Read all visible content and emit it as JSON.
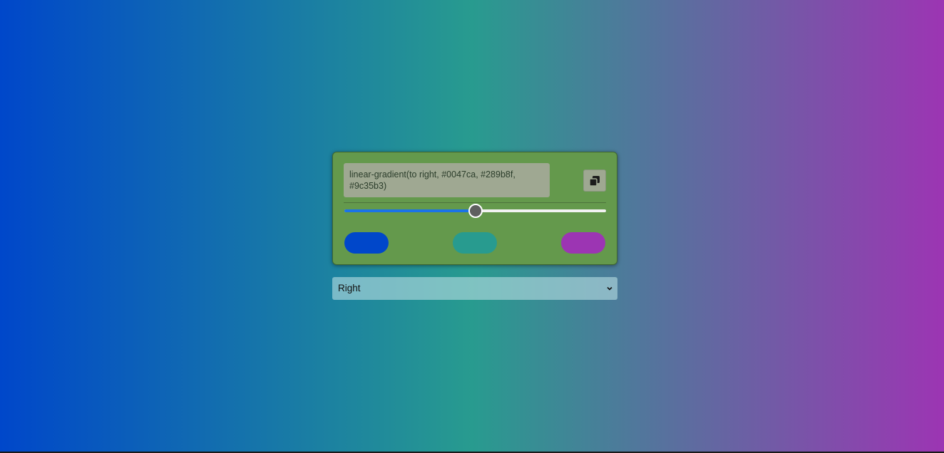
{
  "gradient": {
    "css": "linear-gradient(to right, #0047ca, #289b8f, #9c35b3)",
    "colors": [
      "#0047ca",
      "#289b8f",
      "#9c35b3"
    ]
  },
  "copy_button": {
    "icon": "copy-icon"
  },
  "slider": {
    "value_percent": 50
  },
  "swatches": [
    {
      "color": "#0047ca"
    },
    {
      "color": "#289b8f"
    },
    {
      "color": "#9c35b3"
    }
  ],
  "direction_select": {
    "selected": "Right"
  }
}
